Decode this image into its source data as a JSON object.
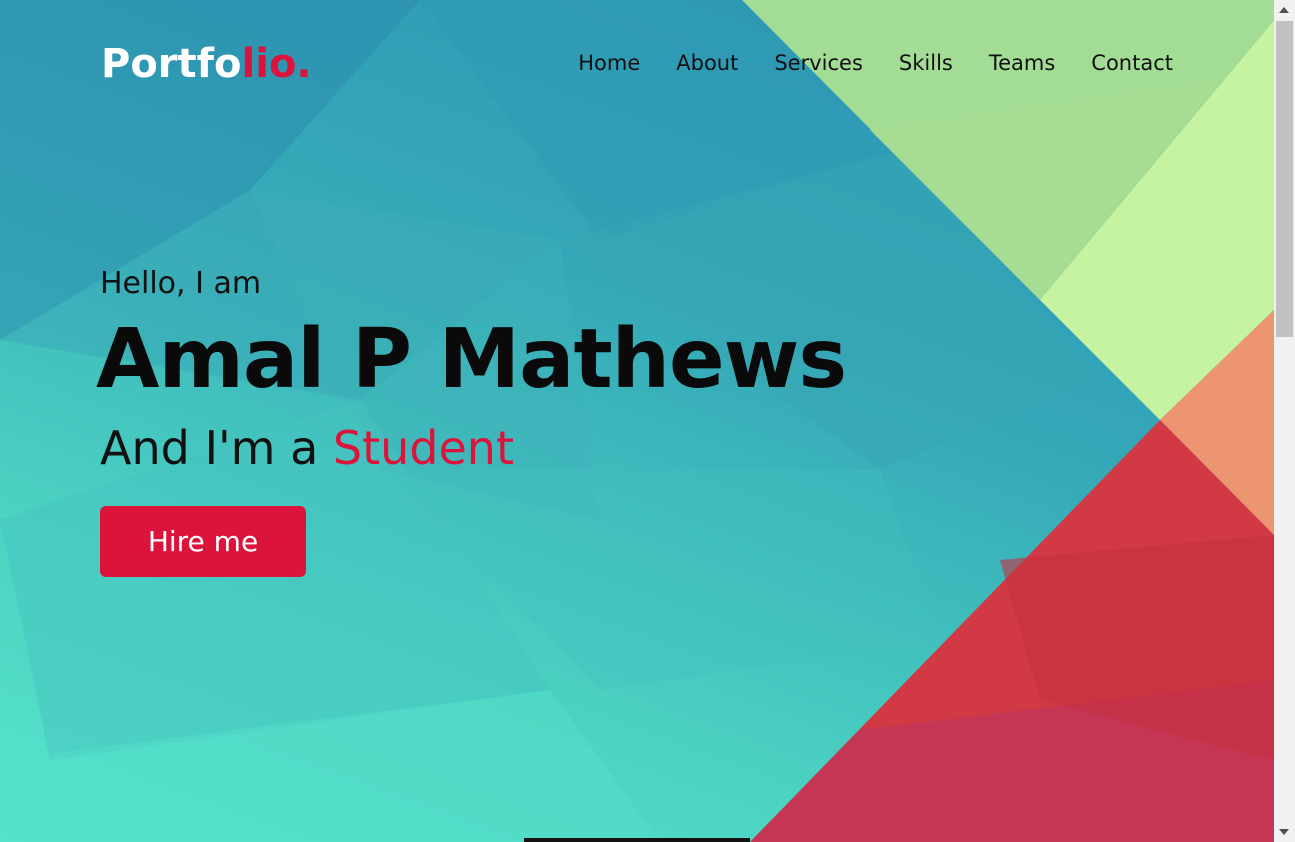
{
  "nav": {
    "logo_main": "Portfo",
    "logo_accent": "lio.",
    "items": [
      {
        "label": "Home"
      },
      {
        "label": "About"
      },
      {
        "label": "Services"
      },
      {
        "label": "Skills"
      },
      {
        "label": "Teams"
      },
      {
        "label": "Contact"
      }
    ]
  },
  "hero": {
    "greeting": "Hello, I am",
    "name": "Amal P Mathews",
    "role_prefix": "And I'm a ",
    "role_highlight": "Student",
    "cta_label": "Hire me"
  },
  "colors": {
    "accent": "#dc143c",
    "text": "#111111",
    "logo": "#ffffff"
  }
}
